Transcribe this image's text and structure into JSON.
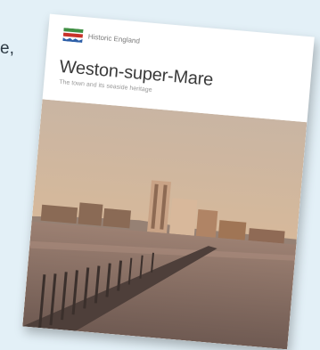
{
  "page": {
    "side_text": "e,"
  },
  "book": {
    "publisher": "Historic England",
    "title": "Weston-super-Mare",
    "subtitle": "The town and its seaside heritage"
  },
  "colors": {
    "background": "#e3f0f7",
    "logo_green": "#3f8f43",
    "logo_red": "#c8322a",
    "logo_blue": "#2d5fa8"
  }
}
